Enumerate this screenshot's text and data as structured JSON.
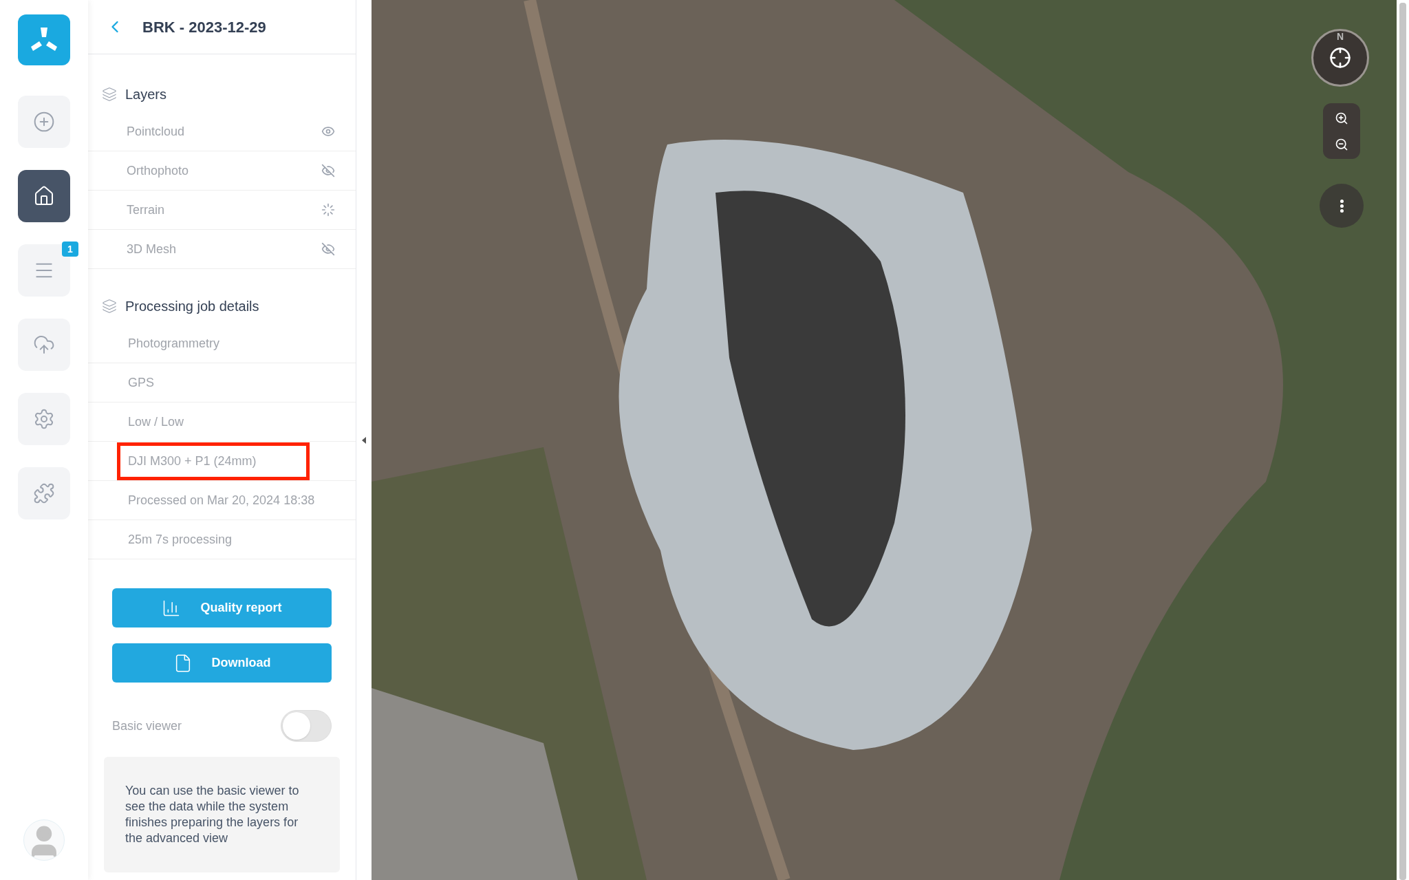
{
  "nav": {
    "badge": "1",
    "items": [
      {
        "kind": "add",
        "selected": false
      },
      {
        "kind": "home",
        "selected": true
      },
      {
        "kind": "list",
        "selected": false
      },
      {
        "kind": "upload",
        "selected": false
      },
      {
        "kind": "settings",
        "selected": false
      },
      {
        "kind": "plugins",
        "selected": false
      }
    ]
  },
  "panel": {
    "title": "BRK - 2023-12-29",
    "layers": {
      "heading": "Layers",
      "items": [
        {
          "label": "Pointcloud",
          "kind": "visible"
        },
        {
          "label": "Orthophoto",
          "kind": "hidden"
        },
        {
          "label": "Terrain",
          "kind": "loading"
        },
        {
          "label": "3D Mesh",
          "kind": "hidden"
        }
      ]
    },
    "details": {
      "heading": "Processing job details",
      "items": [
        {
          "text": "Photogrammetry",
          "highlighted": false
        },
        {
          "text": "GPS",
          "highlighted": false
        },
        {
          "text": "Low / Low",
          "highlighted": false
        },
        {
          "text": "DJI M300 + P1 (24mm)",
          "highlighted": true
        },
        {
          "text": "Processed on Mar 20, 2024 18:38",
          "highlighted": false
        },
        {
          "text": "25m 7s processing",
          "highlighted": false
        }
      ]
    },
    "buttons": [
      {
        "kind": "report",
        "label": "Quality report"
      },
      {
        "kind": "download",
        "label": "Download"
      }
    ],
    "basic_viewer": {
      "label": "Basic viewer",
      "on": false
    },
    "note": "You can use the basic viewer to see the data while the system finishes preparing the layers for the advanced view"
  },
  "map": {
    "compass_label": "N"
  }
}
